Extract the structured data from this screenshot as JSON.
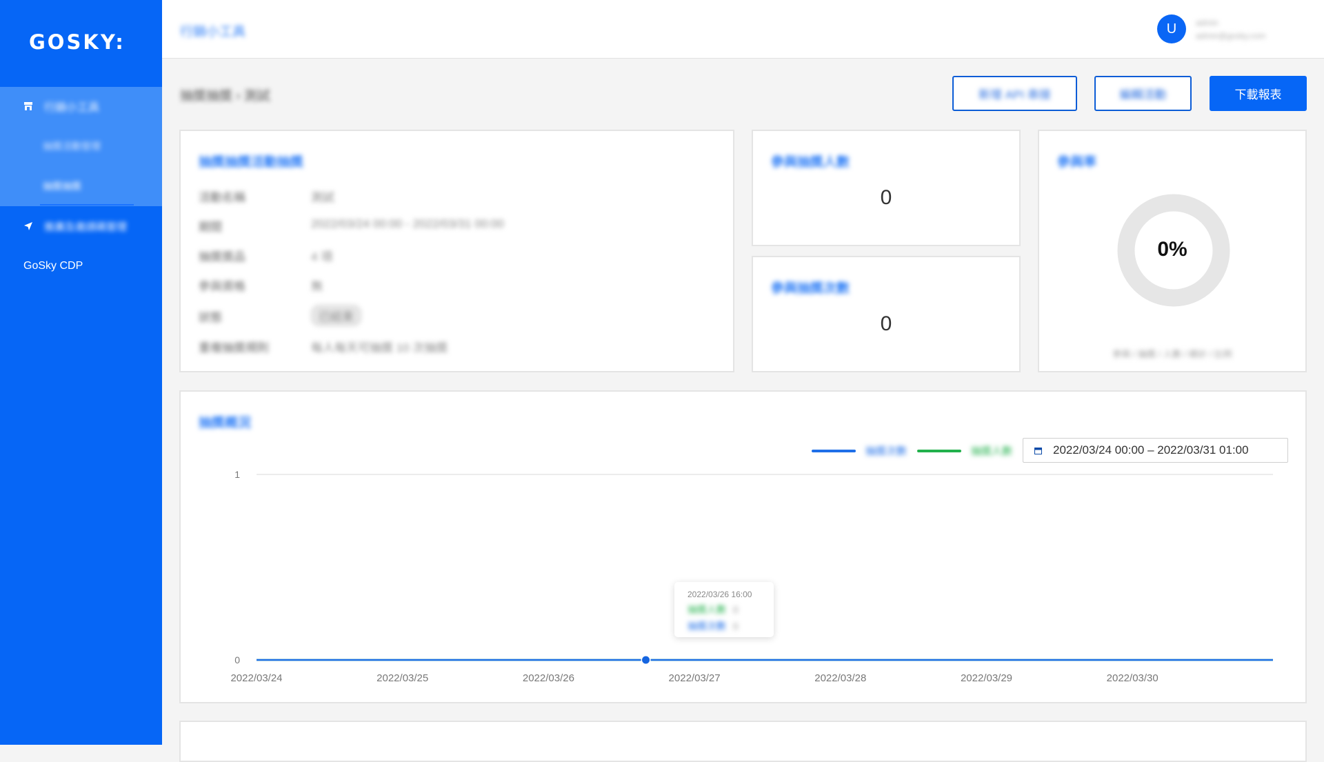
{
  "sidebar": {
    "logo": "GOSKY:",
    "items": [
      {
        "label": "行銷小工具",
        "icon": "store-icon"
      },
      {
        "label": "抽獎活動管理",
        "icon": ""
      },
      {
        "label": "抽獎抽獎",
        "icon": ""
      },
      {
        "label": "推廣及邀請碼管理",
        "icon": "send-icon"
      },
      {
        "label": "GoSky CDP",
        "icon": ""
      }
    ]
  },
  "header": {
    "title": "行銷小工具",
    "avatar_letter": "U",
    "user_name": "admin",
    "user_email": "admin@gosky.com"
  },
  "breadcrumb": "抽獎抽獎 › 測試",
  "toolbar": {
    "api_button": "新增 API 串接",
    "edit_button": "編輯活動",
    "download_button": "下載報表"
  },
  "info_card": {
    "title": "抽獎抽獎活動抽獎",
    "rows": [
      {
        "label": "活動名稱",
        "value": "測試"
      },
      {
        "label": "期間",
        "value": "2022/03/24 00:00 - 2022/03/31 00:00"
      },
      {
        "label": "抽獎獎品",
        "value": "4 項"
      },
      {
        "label": "參與資格",
        "value": "無"
      },
      {
        "label": "狀態",
        "value": "已結束"
      },
      {
        "label": "重複抽獎規則",
        "value": "每人每天可抽獎 10 次抽獎"
      }
    ]
  },
  "stat_participants": {
    "title": "參與抽獎人數",
    "value": "0"
  },
  "stat_draws": {
    "title": "參與抽獎次數",
    "value": "0"
  },
  "rate_card": {
    "title": "參與率",
    "percent": "0%",
    "caption": "參與 / 抽獎 / 人數 / 總計 / 比例"
  },
  "chart_card": {
    "title": "抽獎概況",
    "legend": [
      {
        "name": "抽獎次數",
        "color": "#1f6fe8"
      },
      {
        "name": "抽獎人數",
        "color": "#22b14c"
      }
    ],
    "date_range": "2022/03/24 00:00 – 2022/03/31 01:00",
    "tooltip": {
      "time": "2022/03/26  16:00",
      "rows": [
        {
          "label": "抽獎人數",
          "value": "0",
          "color": "#22b14c"
        },
        {
          "label": "抽獎次數",
          "value": "0",
          "color": "#1f6fe8"
        }
      ]
    }
  },
  "chart_data": {
    "type": "line",
    "categories": [
      "2022/03/24",
      "2022/03/25",
      "2022/03/26",
      "2022/03/27",
      "2022/03/28",
      "2022/03/29",
      "2022/03/30"
    ],
    "series": [
      {
        "name": "抽獎次數",
        "values": [
          0,
          0,
          0,
          0,
          0,
          0,
          0
        ]
      },
      {
        "name": "抽獎人數",
        "values": [
          0,
          0,
          0,
          0,
          0,
          0,
          0
        ]
      }
    ],
    "yticks": [
      "1",
      "0"
    ],
    "ylim": [
      0,
      1
    ],
    "highlight_x": "2022/03/26  16:00"
  }
}
